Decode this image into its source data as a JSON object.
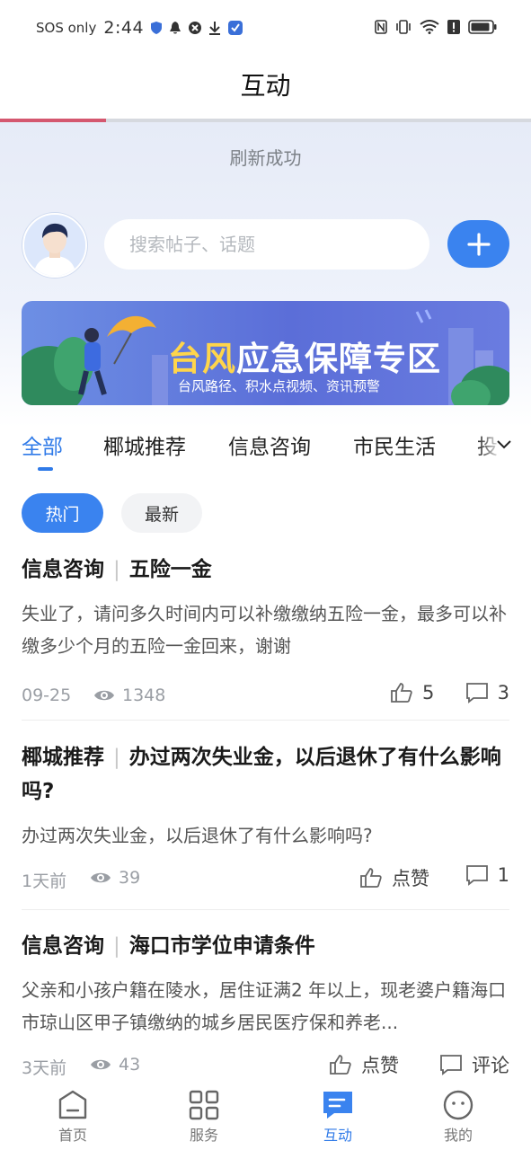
{
  "status_bar": {
    "carrier": "SOS only",
    "time": "2:44",
    "signal_label": "6"
  },
  "header": {
    "title": "互动",
    "progress": 0.2
  },
  "refresh": {
    "text": "刷新成功"
  },
  "search": {
    "placeholder": "搜索帖子、话题"
  },
  "banner": {
    "title_highlight": "台风",
    "title_rest": "应急保障专区",
    "subtitle": "台风路径、积水点视频、资讯预警"
  },
  "tabs": [
    {
      "label": "全部",
      "active": true
    },
    {
      "label": "椰城推荐"
    },
    {
      "label": "信息咨询"
    },
    {
      "label": "市民生活"
    },
    {
      "label": "投"
    }
  ],
  "filters": {
    "hot": "热门",
    "latest": "最新"
  },
  "posts": [
    {
      "category": "信息咨询",
      "title": "五险一金",
      "body": "失业了，请问多久时间内可以补缴缴纳五险一金，最多可以补缴多少个月的五险一金回来，谢谢",
      "date": "09-25",
      "views": "1348",
      "likes": "5",
      "comments": "3"
    },
    {
      "category": "椰城推荐",
      "title": "办过两次失业金，以后退休了有什么影响吗?",
      "body": "办过两次失业金，以后退休了有什么影响吗?",
      "date": "1天前",
      "views": "39",
      "likes": "点赞",
      "comments": "1"
    },
    {
      "category": "信息咨询",
      "title": "海口市学位申请条件",
      "body": "父亲和小孩户籍在陵水，居住证满2 年以上，现老婆户籍海口市琼山区甲子镇缴纳的城乡居民医疗保和养老...",
      "date": "3天前",
      "views": "43",
      "likes": "点赞",
      "comments": "评论"
    }
  ],
  "bottom_nav": [
    {
      "label": "首页",
      "icon": "home-icon"
    },
    {
      "label": "服务",
      "icon": "grid-icon"
    },
    {
      "label": "互动",
      "icon": "chat-icon",
      "active": true
    },
    {
      "label": "我的",
      "icon": "face-icon"
    }
  ],
  "colors": {
    "accent": "#3a83ef",
    "progress": "#d4576f",
    "banner_yellow": "#ffd54a"
  }
}
